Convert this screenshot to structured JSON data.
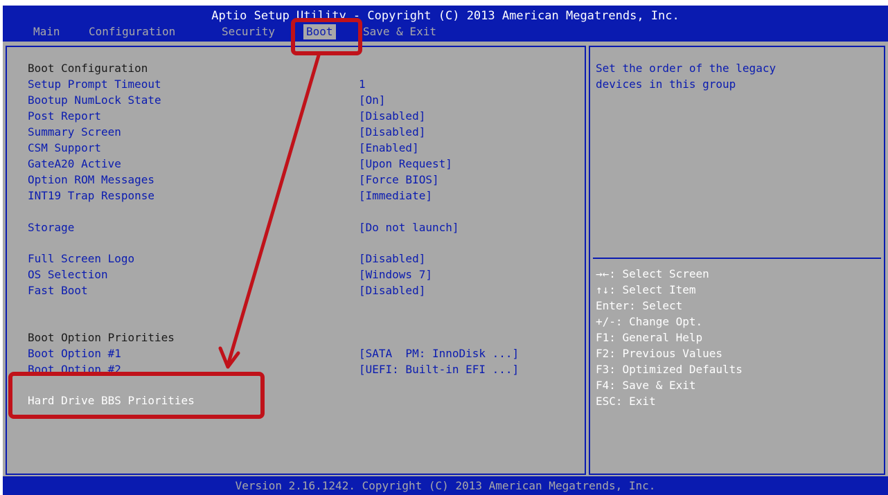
{
  "title": "Aptio Setup Utility - Copyright (C) 2013 American Megatrends, Inc.",
  "menu_tabs": [
    {
      "label": "Main"
    },
    {
      "label": "Configuration"
    },
    {
      "label": "Security"
    },
    {
      "label": "Boot",
      "active": true
    },
    {
      "label": "Save & Exit"
    }
  ],
  "settings": {
    "boot_configuration_heading": "Boot Configuration",
    "setup_prompt_timeout": {
      "label": "Setup Prompt Timeout",
      "value": "1"
    },
    "bootup_numlock_state": {
      "label": "Bootup NumLock State",
      "value": "[On]"
    },
    "post_report": {
      "label": "Post Report",
      "value": "[Disabled]"
    },
    "summary_screen": {
      "label": "Summary Screen",
      "value": "[Disabled]"
    },
    "csm_support": {
      "label": "CSM Support",
      "value": "[Enabled]"
    },
    "gatea20_active": {
      "label": "GateA20 Active",
      "value": "[Upon Request]"
    },
    "option_rom_messages": {
      "label": "Option ROM Messages",
      "value": "[Force BIOS]"
    },
    "int19_trap_response": {
      "label": "INT19 Trap Response",
      "value": "[Immediate]"
    },
    "storage": {
      "label": "Storage",
      "value": "[Do not launch]"
    },
    "full_screen_logo": {
      "label": "Full Screen Logo",
      "value": "[Disabled]"
    },
    "os_selection": {
      "label": "OS Selection",
      "value": "[Windows 7]"
    },
    "fast_boot": {
      "label": "Fast Boot",
      "value": "[Disabled]"
    },
    "boot_option_priorities_heading": "Boot Option Priorities",
    "boot_option_1": {
      "label": "Boot Option #1",
      "value": "[SATA  PM: InnoDisk ...]"
    },
    "boot_option_2": {
      "label": "Boot Option #2",
      "value": "[UEFI: Built-in EFI ...]"
    },
    "hard_drive_bbs_priorities": {
      "label": "Hard Drive BBS Priorities"
    }
  },
  "help": {
    "line1": "Set the order of the legacy",
    "line2": "devices in this group"
  },
  "key_help": [
    "→←: Select Screen",
    "↑↓: Select Item",
    "Enter: Select",
    "+/-: Change Opt.",
    "F1: General Help",
    "F2: Previous Values",
    "F3: Optimized Defaults",
    "F4: Save & Exit",
    "ESC: Exit"
  ],
  "footer": "Version 2.16.1242. Copyright (C) 2013 American Megatrends, Inc.",
  "colors": {
    "bios_blue": "#0a1bb0",
    "bios_gray": "#a8a8a8",
    "annotation_red": "#c0121a"
  }
}
